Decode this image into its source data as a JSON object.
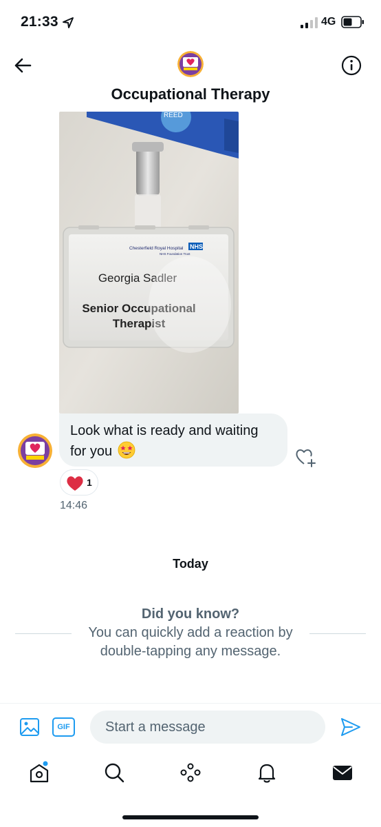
{
  "status_bar": {
    "time": "21:33",
    "network": "4G"
  },
  "header": {
    "title": "Occupational Therapy",
    "icons": [
      "back-arrow-icon",
      "avatar",
      "info-icon"
    ]
  },
  "photo": {
    "badge_hospital": "Chesterfield Royal Hospital",
    "badge_trust": "NHS Foundation Trust",
    "badge_nhs": "NHS",
    "badge_name": "Georgia Sadler",
    "badge_role_line1": "Senior Occupational",
    "badge_role_line2": "Therapist",
    "pen_text": "REED"
  },
  "message": {
    "text": "Look what is ready and waiting for you",
    "emoji": "star-struck-emoji",
    "reaction_count": "1",
    "time": "14:46"
  },
  "day_separator": "Today",
  "tip": {
    "title": "Did you know?",
    "body": "You can quickly add a reaction by double-tapping any message."
  },
  "composer": {
    "gif_label": "GIF",
    "placeholder": "Start a message"
  },
  "tabs": [
    "home-icon",
    "search-icon",
    "spaces-icon",
    "notifications-icon",
    "messages-icon"
  ],
  "colors": {
    "accent": "#1d9bf0",
    "bubble": "#eff3f4",
    "heart": "#f91880",
    "text": "#0f1419",
    "muted": "#536471"
  }
}
